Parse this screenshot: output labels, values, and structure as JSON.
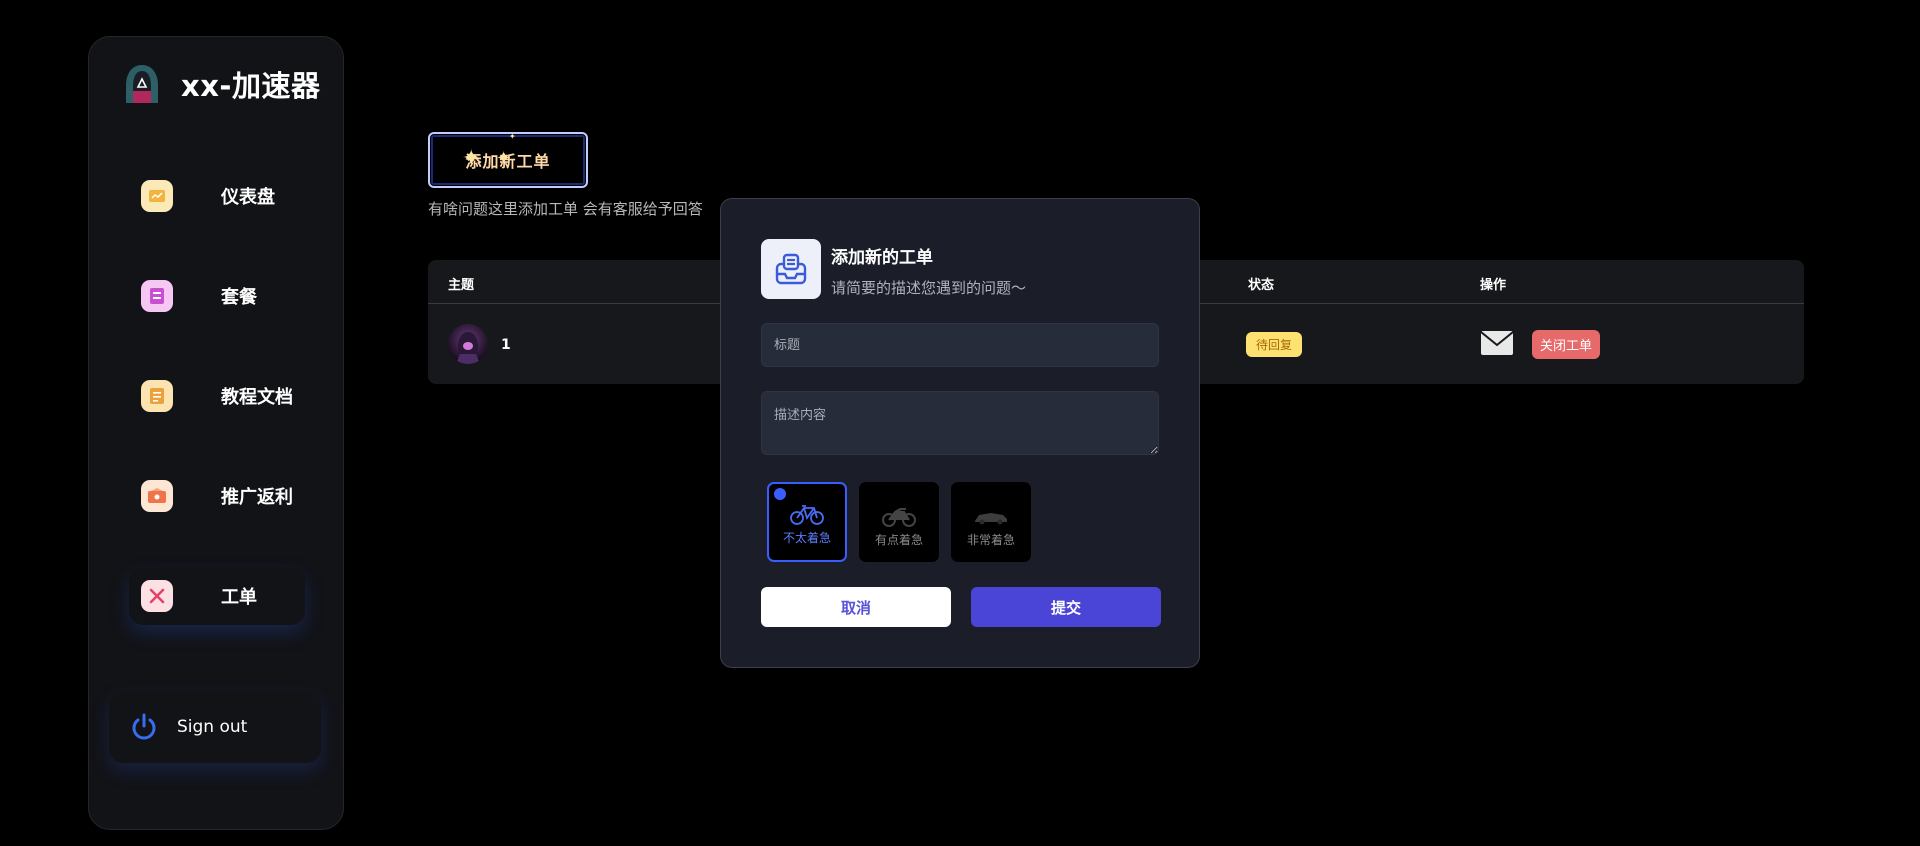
{
  "brand": {
    "title": "xx-加速器",
    "logo": "hooded-figure-logo"
  },
  "sidebar": {
    "items": [
      {
        "label": "仪表盘",
        "icon": "dashboard-icon",
        "color": "#fce9b8"
      },
      {
        "label": "套餐",
        "icon": "package-icon",
        "color": "#f6c7f2"
      },
      {
        "label": "教程文档",
        "icon": "document-icon",
        "color": "#fce3b0"
      },
      {
        "label": "推广返利",
        "icon": "promotion-icon",
        "color": "#fde6d3"
      },
      {
        "label": "工单",
        "icon": "tools-icon",
        "color": "#fde0e4",
        "active": true
      }
    ],
    "signout": {
      "label": "Sign out",
      "icon": "power-icon"
    }
  },
  "main": {
    "add_button": "添加新工单",
    "hint": "有啥问题这里添加工单 会有客服给予回答",
    "table": {
      "headers": {
        "subject": "主题",
        "status": "状态",
        "actions": "操作"
      },
      "rows": [
        {
          "subject": "1",
          "status": "待回复",
          "action": "关闭工单"
        }
      ]
    }
  },
  "modal": {
    "title": "添加新的工单",
    "subtitle": "请简要的描述您遇到的问题～",
    "title_placeholder": "标题",
    "desc_placeholder": "描述内容",
    "urgency": [
      {
        "label": "不太着急",
        "icon": "bicycle-icon",
        "selected": true
      },
      {
        "label": "有点着急",
        "icon": "motorcycle-icon",
        "selected": false
      },
      {
        "label": "非常着急",
        "icon": "race-car-icon",
        "selected": false
      }
    ],
    "cancel": "取消",
    "submit": "提交"
  },
  "colors": {
    "accent": "#4a45d6",
    "selected": "#3a5dff",
    "pending": "#fde272",
    "danger": "#e66a6a"
  }
}
